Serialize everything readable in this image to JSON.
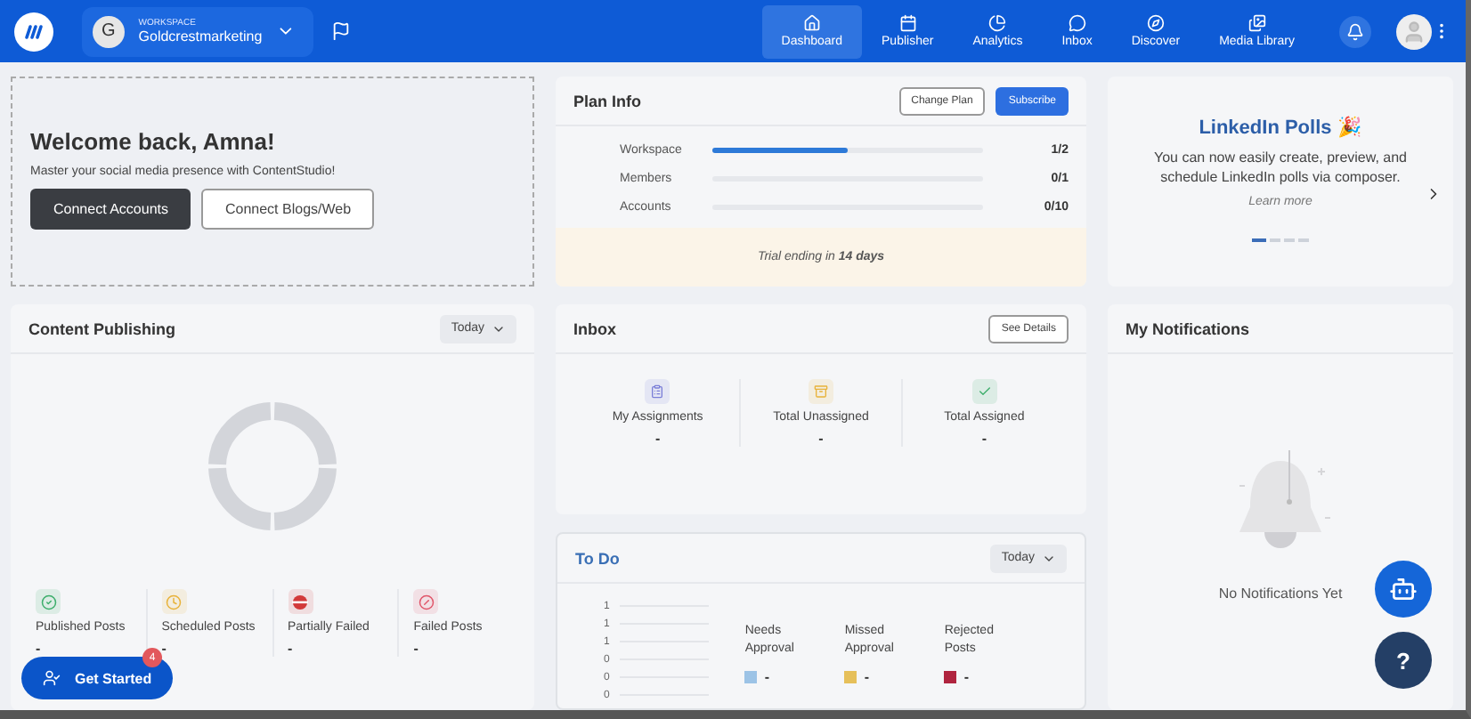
{
  "topbar": {
    "workspace": {
      "initial": "G",
      "label": "WORKSPACE",
      "name": "Goldcrestmarketing"
    },
    "nav": [
      {
        "kind": "home",
        "label": "Dashboard",
        "selected": true
      },
      {
        "kind": "calendar",
        "label": "Publisher",
        "selected": false
      },
      {
        "kind": "chart",
        "label": "Analytics",
        "selected": false
      },
      {
        "kind": "chat",
        "label": "Inbox",
        "selected": false
      },
      {
        "kind": "compass",
        "label": "Discover",
        "selected": false
      },
      {
        "kind": "media",
        "label": "Media Library",
        "selected": false
      }
    ]
  },
  "welcome": {
    "title": "Welcome back, Amna!",
    "subtitle": "Master your social media presence with ContentStudio!",
    "buttons": [
      {
        "label": "Connect Accounts",
        "kind": "primary"
      },
      {
        "label": "Connect Blogs/Web",
        "kind": "outline"
      }
    ]
  },
  "plan": {
    "title": "Plan Info",
    "buttons": [
      {
        "label": "Change Plan",
        "kind": "outline"
      },
      {
        "label": "Subscribe",
        "kind": "primary"
      }
    ],
    "rows": [
      {
        "label": "Workspace",
        "level": 0.5,
        "reading": "1/2"
      },
      {
        "label": "Members",
        "level": 0,
        "reading": "0/1"
      },
      {
        "label": "Accounts",
        "level": 0,
        "reading": "0/10"
      }
    ],
    "trial": "Trial ending in **14 days**"
  },
  "promo": {
    "title": "LinkedIn Polls 🎉",
    "text": "You can now easily create, preview, and schedule LinkedIn polls via composer.",
    "link": "Learn more",
    "dots": [
      {
        "selected": true
      },
      {
        "selected": false
      },
      {
        "selected": false
      },
      {
        "selected": false
      }
    ]
  },
  "publishing": {
    "title": "Content Publishing",
    "period": "Today",
    "stats": [
      {
        "label": "Published Posts",
        "value": "-",
        "color": "#3dae6b"
      },
      {
        "label": "Scheduled Posts",
        "value": "-",
        "color": "#e8b23a"
      },
      {
        "label": "Partially Failed",
        "value": "-",
        "color": "#d23a3a"
      },
      {
        "label": "Failed Posts",
        "value": "-",
        "color": "#e0566a"
      }
    ]
  },
  "inbox": {
    "title": "Inbox",
    "button": "See Details",
    "stats": [
      {
        "label": "My Assignments",
        "value": "-",
        "color": "#7b7fd8"
      },
      {
        "label": "Total Unassigned",
        "value": "-",
        "color": "#e8b23a"
      },
      {
        "label": "Total Assigned",
        "value": "-",
        "color": "#3dae6b"
      }
    ]
  },
  "todo": {
    "title": "To Do",
    "period": "Today",
    "axis": [
      "1",
      "1",
      "1",
      "0",
      "0",
      "0"
    ],
    "legend": [
      {
        "label": "Needs Approval",
        "value": "-",
        "color": "#9cc3e6"
      },
      {
        "label": "Missed Approval",
        "value": "-",
        "color": "#e6c05a"
      },
      {
        "label": "Rejected Posts",
        "value": "-",
        "color": "#b0243f"
      }
    ]
  },
  "notifications": {
    "title": "My Notifications",
    "empty": "No Notifications Yet"
  },
  "get_started": {
    "label": "Get Started",
    "badge": "4"
  },
  "help": {
    "label": "?"
  }
}
